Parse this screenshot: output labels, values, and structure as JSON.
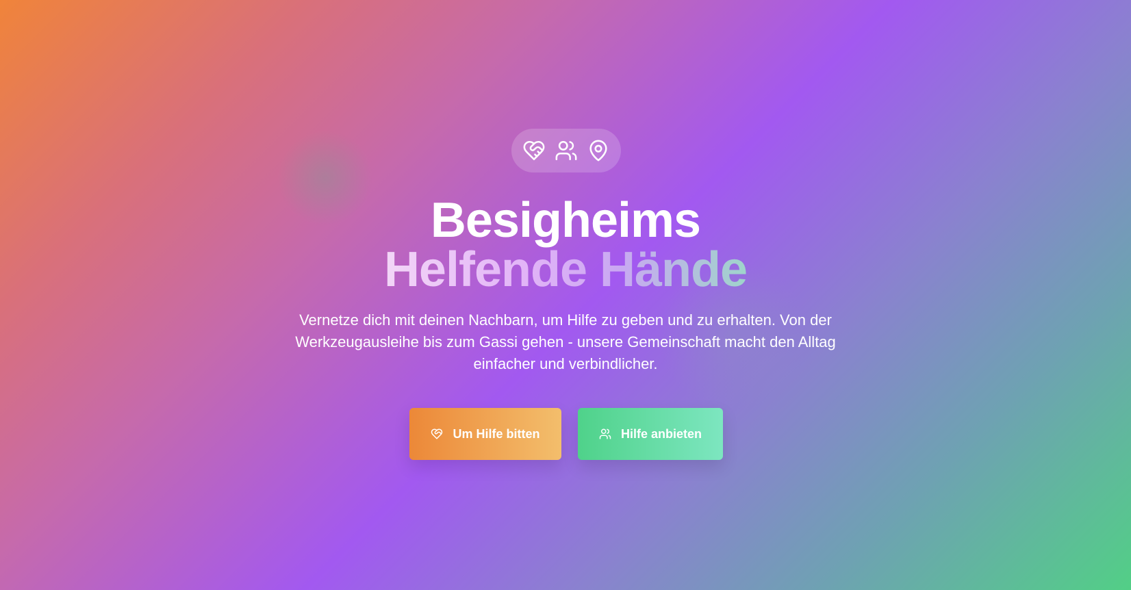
{
  "hero": {
    "icons": [
      "heart-handshake-icon",
      "users-icon",
      "map-pin-icon"
    ],
    "title_line1": "Besigheims",
    "title_line2": "Helfende Hände",
    "subtitle": "Vernetze dich mit deinen Nachbarn, um Hilfe zu geben und zu erhalten. Von der Werkzeugausleihe bis zum Gassi gehen - unsere Gemeinschaft macht den Alltag einfacher und verbindlicher."
  },
  "buttons": {
    "request_help": {
      "label": "Um Hilfe bitten",
      "icon": "heart-handshake-icon",
      "color": "#ec8838"
    },
    "offer_help": {
      "label": "Hilfe anbieten",
      "icon": "users-icon",
      "color": "#4fd28a"
    }
  },
  "colors": {
    "gradient_start": "#f0843a",
    "gradient_mid": "#a259f0",
    "gradient_end": "#52cf86"
  }
}
